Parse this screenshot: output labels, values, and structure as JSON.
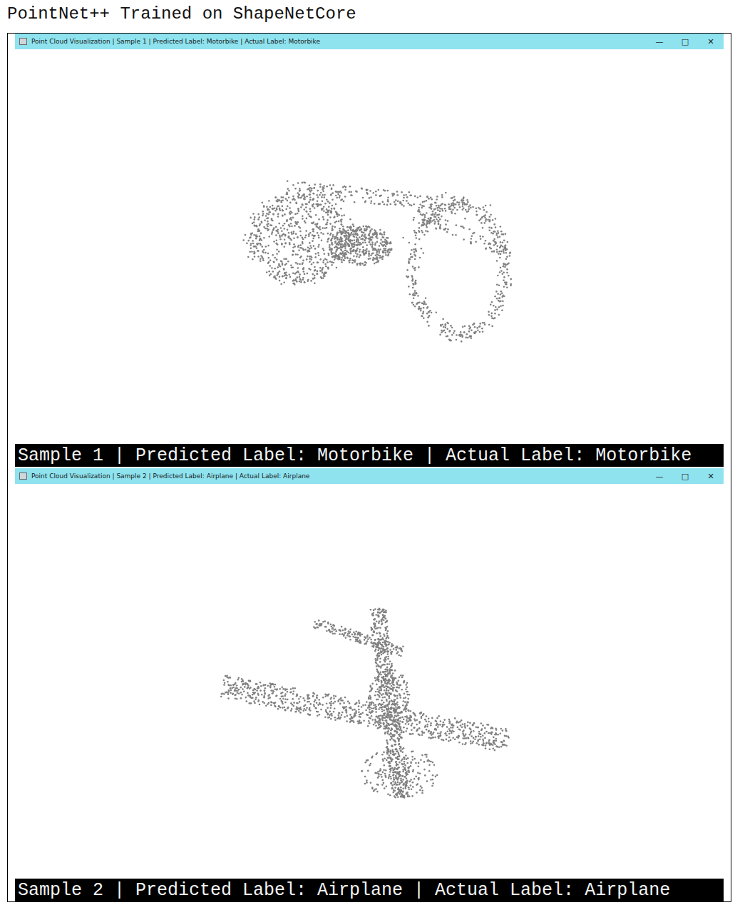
{
  "heading": "PointNet++ Trained on ShapeNetCore",
  "windows": [
    {
      "title": "Point Cloud Visualization | Sample 1 | Predicted Label: Motorbike | Actual Label: Motorbike",
      "controls": [
        "—",
        "□",
        "✕"
      ],
      "kind": "motorbike",
      "caption": "Sample 1 | Predicted Label: Motorbike | Actual Label: Motorbike"
    },
    {
      "title": "Point Cloud Visualization | Sample 2 | Predicted Label: Airplane | Actual Label: Airplane",
      "controls": [
        "—",
        "□",
        "✕"
      ],
      "kind": "airplane",
      "caption": "Sample 2 | Predicted Label: Airplane | Actual Label: Airplane"
    }
  ]
}
